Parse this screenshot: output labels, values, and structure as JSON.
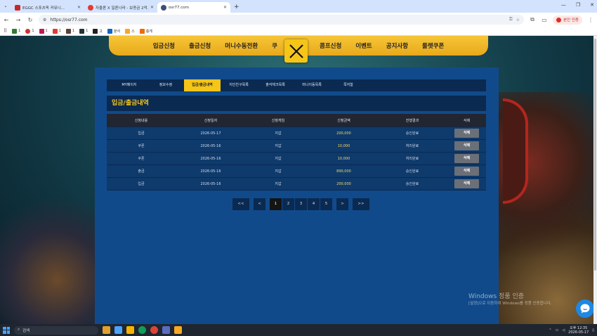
{
  "browser": {
    "tabs": [
      {
        "title": "EGGC 스포츠픽 커뮤니..."
      },
      {
        "title": "자율론 X 일론나라 - 보증금 2억..."
      },
      {
        "title": "osr77.com"
      }
    ],
    "url": "https://osr77.com",
    "profile_label": "본인 인증",
    "bookmarks": [
      "1",
      "1",
      "1",
      "1",
      "1",
      "1",
      "고",
      "분석",
      "스",
      "충게"
    ]
  },
  "site": {
    "nav": [
      "입금신청",
      "출금신청",
      "머니수동전환",
      "쿠",
      "콤프신청",
      "이벤트",
      "공지사항",
      "룰렛쿠폰"
    ],
    "subtabs": [
      "MY페이지",
      "정보수정",
      "입금/출금내역",
      "지인친구목록",
      "출석체크목록",
      "머니이동목록",
      "쪽지함"
    ],
    "active_subtab": "입금/출금내역",
    "section_title": "입금/출금내역",
    "table": {
      "headers": [
        "신청내용",
        "신청일자",
        "신청게임",
        "신청금액",
        "진행결과",
        "삭제"
      ],
      "rows": [
        {
          "type": "입금",
          "date": "2026-05-17",
          "game": "지갑",
          "amount": "200,000",
          "status": "승인완료",
          "del": "삭제"
        },
        {
          "type": "쿠폰",
          "date": "2026-05-16",
          "game": "지갑",
          "amount": "10,000",
          "status": "처리완료",
          "del": "삭제"
        },
        {
          "type": "쿠폰",
          "date": "2026-05-16",
          "game": "지갑",
          "amount": "10,000",
          "status": "처리완료",
          "del": "삭제"
        },
        {
          "type": "출금",
          "date": "2026-05-16",
          "game": "지갑",
          "amount": "890,000",
          "status": "승인완료",
          "del": "삭제"
        },
        {
          "type": "입금",
          "date": "2026-05-16",
          "game": "지갑",
          "amount": "200,000",
          "status": "승인완료",
          "del": "삭제"
        }
      ]
    },
    "pagination": {
      "first": "<<",
      "prev": "<",
      "pages": [
        "1",
        "2",
        "3",
        "4",
        "5"
      ],
      "current": "1",
      "next": ">",
      "last": ">>"
    }
  },
  "windows_watermark": {
    "line1": "Windows 정품 인증",
    "line2": "[설정]으로 이동하여 Windows를 정품 인증합니다."
  },
  "taskbar": {
    "search_placeholder": "검색",
    "time": "오후 12:35",
    "date": "2026-05-17"
  },
  "colors": {
    "accent": "#f5c518",
    "panel": "#114a8a",
    "header_row": "#222630"
  }
}
